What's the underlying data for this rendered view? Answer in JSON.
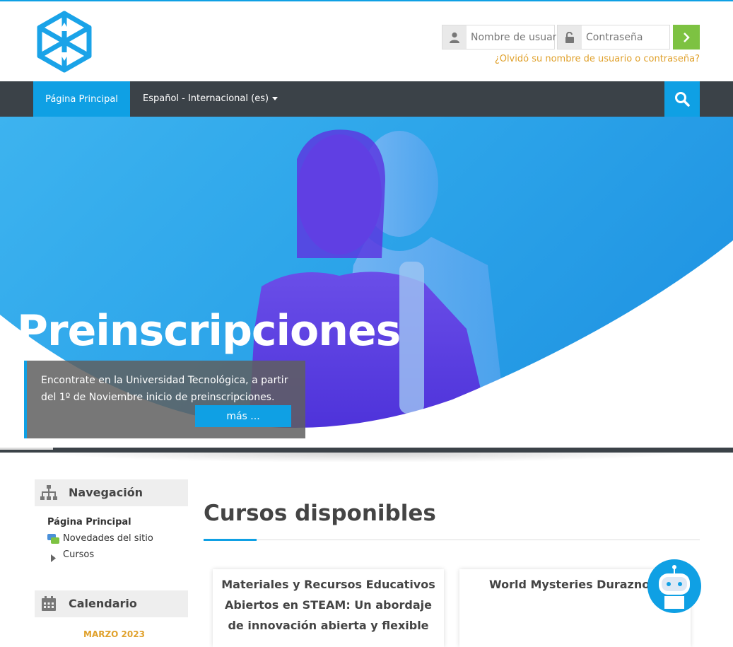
{
  "login": {
    "username_placeholder": "Nombre de usuar",
    "password_placeholder": "Contraseña",
    "forgot_link": "¿Olvidó su nombre de usuario o contraseña?"
  },
  "navbar": {
    "home": "Página Principal",
    "language": "Español - Internacional (es)"
  },
  "hero": {
    "title": "Preinscripciones",
    "text": "Encontrate en la Universidad Tecnológica, a partir del 1º de Noviembre inicio de preinscripciones.",
    "button": "más ..."
  },
  "sidebar": {
    "navigation": {
      "title": "Navegación",
      "home": "Página Principal",
      "news": "Novedades del sitio",
      "courses": "Cursos"
    },
    "calendar": {
      "title": "Calendario",
      "month": "MARZO 2023"
    }
  },
  "main": {
    "title": "Cursos disponibles",
    "cards": [
      {
        "title": "Materiales y Recursos Educativos Abiertos en STEAM: Un abordaje de innovación abierta y flexible"
      },
      {
        "title": "World Mysteries Durazno 20"
      }
    ]
  },
  "colors": {
    "accent": "#0fa0e4",
    "navbar": "#3b4248",
    "login_button": "#7dc242",
    "link_orange": "#e0a12c"
  }
}
